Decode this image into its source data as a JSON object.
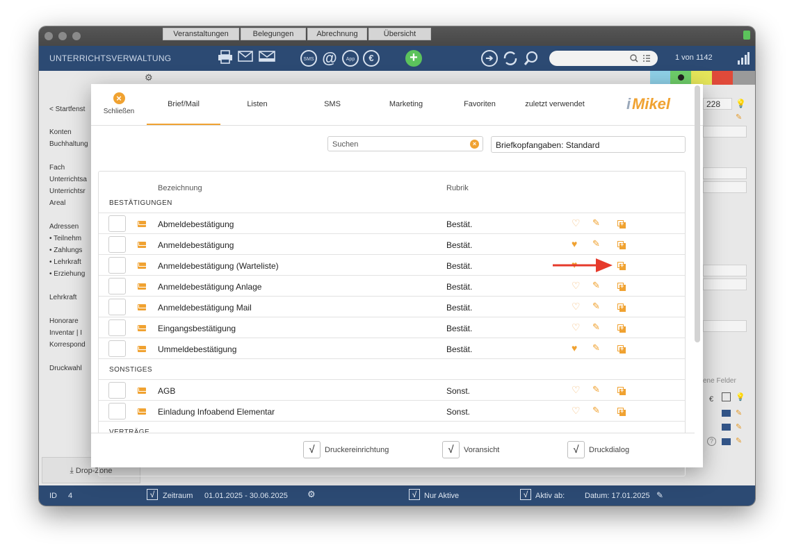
{
  "app": {
    "title": "UNTERRICHTSVERWALTUNG",
    "record_counter": "1 von 1142",
    "toolbar_icons": [
      "printer-icon",
      "envelope-icon",
      "mail-tray-icon",
      "sms-icon",
      "at-icon",
      "app-icon",
      "euro-icon",
      "add-icon",
      "arrow-right-icon",
      "refresh-icon",
      "search-icon",
      "list-icon",
      "bars-icon"
    ],
    "toolbar_labels": {
      "sms": "SMS",
      "app": "App",
      "euro": "€",
      "at": "@"
    }
  },
  "background": {
    "tabs": [
      "Veranstaltungen",
      "Belegungen",
      "Abrechnung",
      "Übersicht"
    ],
    "left_panel": [
      "< Startfenst",
      "Konten",
      "Buchhaltung",
      "Fach",
      "Unterrichtsa",
      "Unterrichtsr",
      "Areal",
      "Adressen",
      "• Teilnehm",
      "• Zahlungs",
      "• Lehrkraft",
      "• Erziehung",
      "Lehrkraft",
      "Honorare",
      "Inventar | I",
      "Korrespond",
      "Druckwahl"
    ],
    "field_value": "228",
    "right_label": "ene Felder",
    "euro": "€",
    "dropzone": "Drop-Zone"
  },
  "bottom_bar": {
    "id_label": "ID",
    "id_value": "4",
    "zeitraum_label": "Zeitraum",
    "zeitraum_value": "01.01.2025  -  30.06.2025",
    "nur_aktive": "Nur Aktive",
    "aktiv_ab": "Aktiv ab:",
    "datum": "Datum: 17.01.2025",
    "check_mark": "√"
  },
  "modal": {
    "close_label": "Schließen",
    "tabs": [
      "Brief/Mail",
      "Listen",
      "SMS",
      "Marketing",
      "Favoriten",
      "zuletzt verwendet"
    ],
    "active_tab": "Brief/Mail",
    "logo": {
      "i": "i",
      "text": "Mikel"
    },
    "search_placeholder": "Suchen",
    "letterhead": "Briefkopfangaben: Standard",
    "columns": {
      "name": "Bezeichnung",
      "rubrik": "Rubrik"
    },
    "sections": [
      {
        "title": "BESTÄTIGUNGEN",
        "rows": [
          {
            "name": "Abmeldebestätigung",
            "rubrik": "Bestät.",
            "favorite": false
          },
          {
            "name": "Anmeldebestätigung",
            "rubrik": "Bestät.",
            "favorite": true
          },
          {
            "name": "Anmeldebestätigung (Warteliste)",
            "rubrik": "Bestät.",
            "favorite": true
          },
          {
            "name": "Anmeldebestätigung Anlage",
            "rubrik": "Bestät.",
            "favorite": false
          },
          {
            "name": "Anmeldebestätigung Mail",
            "rubrik": "Bestät.",
            "favorite": false
          },
          {
            "name": "Eingangsbestätigung",
            "rubrik": "Bestät.",
            "favorite": false
          },
          {
            "name": "Ummeldebestätigung",
            "rubrik": "Bestät.",
            "favorite": true
          }
        ]
      },
      {
        "title": "SONSTIGES",
        "rows": [
          {
            "name": "AGB",
            "rubrik": "Sonst.",
            "favorite": false
          },
          {
            "name": "Einladung Infoabend Elementar",
            "rubrik": "Sonst.",
            "favorite": false
          }
        ]
      },
      {
        "title": "VERTRÄGE",
        "rows": []
      }
    ],
    "footer": [
      {
        "label": "Druckereinrichtung",
        "checked": "√"
      },
      {
        "label": "Voransicht",
        "checked": "√"
      },
      {
        "label": "Druckdialog",
        "checked": "√"
      }
    ]
  },
  "colors": {
    "accent": "#f0a231",
    "header_blue": "#2c4a73",
    "arrow_red": "#e63a2b"
  }
}
